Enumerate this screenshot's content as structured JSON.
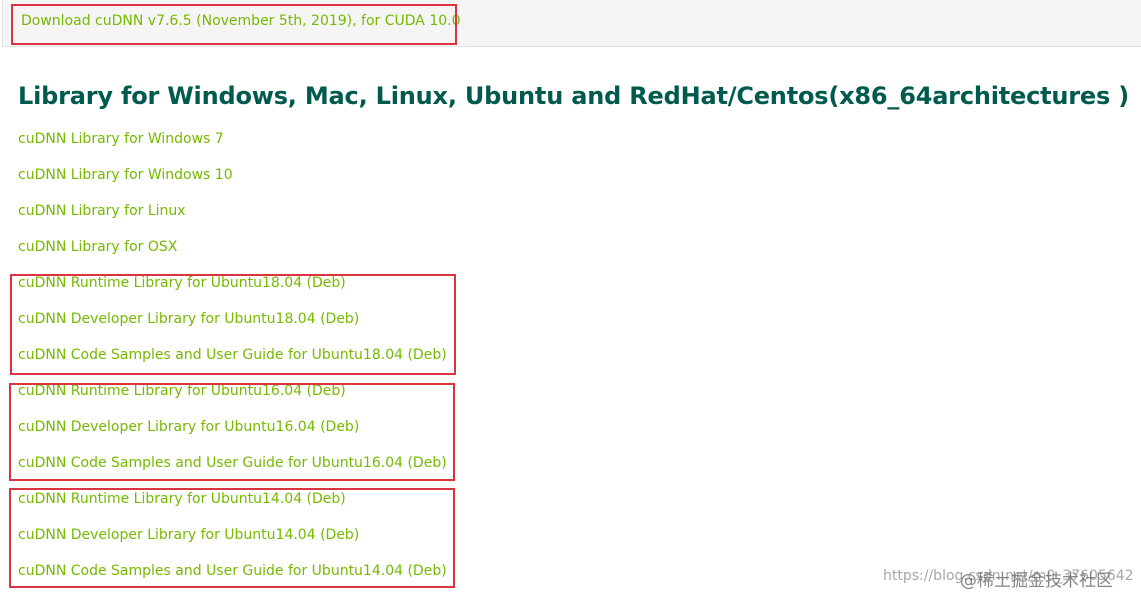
{
  "topbar": {
    "download_link": "Download cuDNN v7.6.5 (November 5th, 2019), for CUDA 10.0"
  },
  "section": {
    "heading": "Library for Windows, Mac, Linux, Ubuntu and RedHat/Centos(x86_64architectures )",
    "items": [
      "cuDNN Library for Windows 7",
      "cuDNN Library for Windows 10",
      "cuDNN Library for Linux",
      "cuDNN Library for OSX",
      "cuDNN Runtime Library for Ubuntu18.04 (Deb)",
      "cuDNN Developer Library for Ubuntu18.04 (Deb)",
      "cuDNN Code Samples and User Guide for Ubuntu18.04 (Deb)",
      "cuDNN Runtime Library for Ubuntu16.04 (Deb)",
      "cuDNN Developer Library for Ubuntu16.04 (Deb)",
      "cuDNN Code Samples and User Guide for Ubuntu16.04 (Deb)",
      "cuDNN Runtime Library for Ubuntu14.04 (Deb)",
      "cuDNN Developer Library for Ubuntu14.04 (Deb)",
      "cuDNN Code Samples and User Guide for Ubuntu14.04 (Deb)"
    ]
  },
  "watermark": {
    "url": "https://blog.csdn.net/m0_37605642",
    "site": "@稀土掘金技术社区"
  },
  "colors": {
    "link": "#76b900",
    "heading": "#005a4e",
    "highlight": "#d9343f"
  }
}
